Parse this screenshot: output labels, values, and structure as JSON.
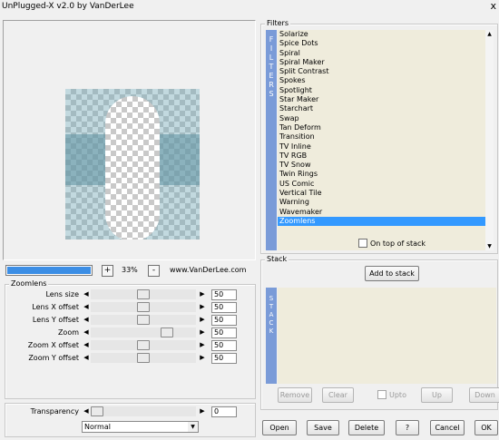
{
  "window": {
    "title": "UnPlugged-X v2.0 by VanDerLee",
    "close_glyph": "x"
  },
  "preview": {
    "zoom_minus": "-",
    "zoom_plus": "+",
    "zoom_value": "33%",
    "link": "www.VanDerLee.com",
    "progress": 1.0
  },
  "zoomlens": {
    "group_label": "Zoomlens",
    "sliders": [
      {
        "label": "Lens size",
        "value": "50",
        "level": 0.5
      },
      {
        "label": "Lens X offset",
        "value": "50",
        "level": 0.5
      },
      {
        "label": "Lens Y offset",
        "value": "50",
        "level": 0.5
      },
      {
        "label": "Zoom",
        "value": "50",
        "level": 0.75
      },
      {
        "label": "Zoom X offset",
        "value": "50",
        "level": 0.5
      },
      {
        "label": "Zoom Y offset",
        "value": "50",
        "level": 0.5
      }
    ]
  },
  "transparency": {
    "label": "Transparency",
    "value": "0",
    "level": 0.0
  },
  "blend_mode": {
    "selected": "Normal"
  },
  "filters": {
    "group_label": "Filters",
    "vertical_letters": [
      "F",
      "I",
      "L",
      "T",
      "E",
      "R",
      "S"
    ],
    "items": [
      "Solarize",
      "Spice Dots",
      "Spiral",
      "Spiral Maker",
      "Split Contrast",
      "Spokes",
      "Spotlight",
      "Star Maker",
      "Starchart",
      "Swap",
      "Tan Deform",
      "Transition",
      "TV Inline",
      "TV RGB",
      "TV Snow",
      "Twin Rings",
      "US Comic",
      "Vertical Tile",
      "Warning",
      "Wavemaker",
      "Zoomlens"
    ],
    "selected": "Zoomlens",
    "on_top_label": "On top of stack"
  },
  "stack": {
    "group_label": "Stack",
    "vertical_letters": [
      "S",
      "T",
      "A",
      "C",
      "K"
    ],
    "add_label": "Add to stack",
    "remove_label": "Remove",
    "clear_label": "Clear",
    "upto_label": "Upto",
    "up_label": "Up",
    "down_label": "Down"
  },
  "footer": {
    "open_label": "Open",
    "save_label": "Save",
    "delete_label": "Delete",
    "help_label": "?",
    "cancel_label": "Cancel",
    "ok_label": "OK"
  },
  "colors": {
    "accent": "#3399ff",
    "list_bg": "#efecdc",
    "side_bar": "#7a9bd8"
  }
}
